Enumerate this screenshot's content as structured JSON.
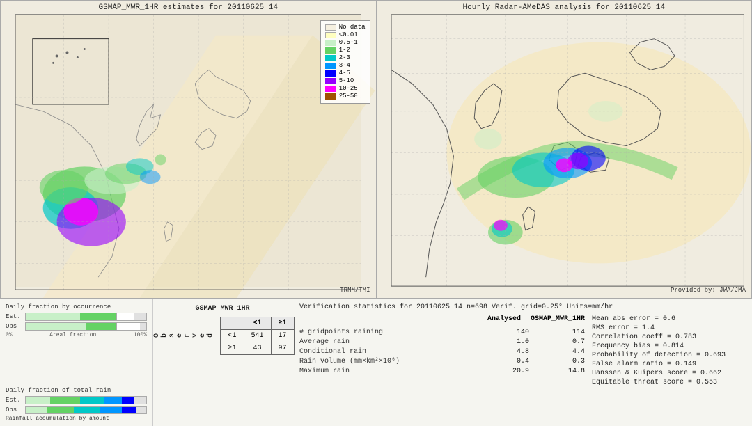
{
  "map1": {
    "title": "GSMAP_MWR_1HR estimates for 20110625 14",
    "bottom_label": "TRMM/TMI",
    "axis_lats": [
      "25",
      "20",
      "15",
      "10"
    ],
    "axis_lons": [
      "15",
      "20",
      "25"
    ]
  },
  "map2": {
    "title": "Hourly Radar-AMeDAS analysis for 20110625 14",
    "bottom_label": "Provided by: JWA/JMA",
    "axis_lats": [
      "45",
      "40",
      "35",
      "30",
      "25",
      "20"
    ],
    "axis_lons": [
      "125",
      "130",
      "135",
      "140",
      "145"
    ]
  },
  "legend": {
    "items": [
      {
        "label": "No data",
        "color": "#f5f0e0"
      },
      {
        "label": "<0.01",
        "color": "#ffffc0"
      },
      {
        "label": "0.5-1",
        "color": "#c8f0c8"
      },
      {
        "label": "1-2",
        "color": "#64d264"
      },
      {
        "label": "2-3",
        "color": "#00c8c8"
      },
      {
        "label": "3-4",
        "color": "#0096ff"
      },
      {
        "label": "4-5",
        "color": "#0000ff"
      },
      {
        "label": "5-10",
        "color": "#9600ff"
      },
      {
        "label": "10-25",
        "color": "#ff00ff"
      },
      {
        "label": "25-50",
        "color": "#a05000"
      }
    ]
  },
  "bar_charts": {
    "section1_title": "Daily fraction by occurrence",
    "est_label": "Est.",
    "obs_label": "Obs",
    "axis_left": "0%",
    "axis_right": "100%",
    "axis_mid": "Areal fraction",
    "section2_title": "Daily fraction of total rain",
    "est2_label": "Est.",
    "obs2_label": "Obs",
    "rainfall_label": "Rainfall accumulation by amount"
  },
  "contingency": {
    "title": "GSMAP_MWR_1HR",
    "col_lt1": "<1",
    "col_gte1": "≥1",
    "row_lt1": "<1",
    "row_gte1": "≥1",
    "observed_label": "O\nb\ns\ne\nr\nv\ne\nd",
    "cells": {
      "tl": "541",
      "tr": "17",
      "bl": "43",
      "br": "97"
    }
  },
  "verification": {
    "title": "Verification statistics for 20110625 14  n=698  Verif. grid=0.25°  Units=mm/hr",
    "col_headers": [
      "Analysed",
      "GSMAP_MWR_1HR"
    ],
    "metrics": [
      {
        "name": "# gridpoints raining",
        "val1": "140",
        "val2": "114"
      },
      {
        "name": "Average rain",
        "val1": "1.0",
        "val2": "0.7"
      },
      {
        "name": "Conditional rain",
        "val1": "4.8",
        "val2": "4.4"
      },
      {
        "name": "Rain volume (mm×km²×10⁶)",
        "val1": "0.4",
        "val2": "0.3"
      },
      {
        "name": "Maximum rain",
        "val1": "20.9",
        "val2": "14.8"
      }
    ],
    "right_stats": [
      {
        "label": "Mean abs error = 0.6"
      },
      {
        "label": "RMS error = 1.4"
      },
      {
        "label": "Correlation coeff = 0.783"
      },
      {
        "label": "Frequency bias = 0.814"
      },
      {
        "label": "Probability of detection = 0.693"
      },
      {
        "label": "False alarm ratio = 0.149"
      },
      {
        "label": "Hanssen & Kuipers score = 0.662"
      },
      {
        "label": "Equitable threat score = 0.553"
      }
    ]
  }
}
